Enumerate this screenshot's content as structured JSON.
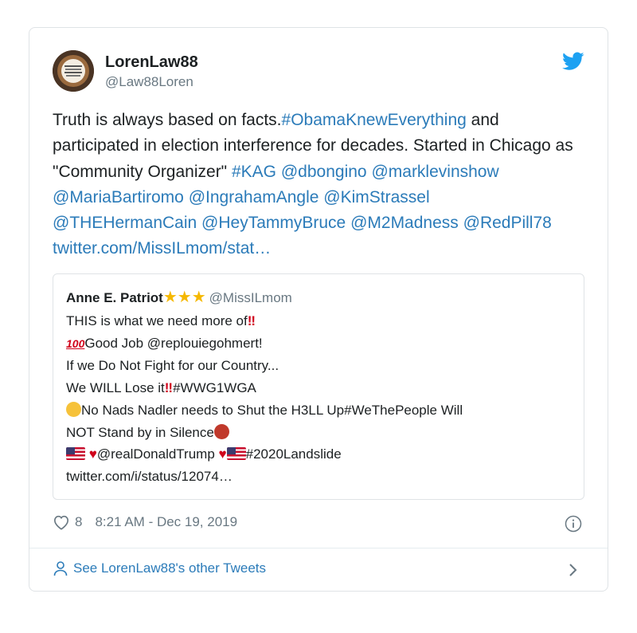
{
  "author": {
    "name": "LorenLaw88",
    "handle": "@Law88Loren",
    "avatar_icon": "profile-avatar",
    "platform_icon": "twitter-bird-icon"
  },
  "tweet": {
    "segments": [
      {
        "text": "Truth is always based on facts.",
        "link": false
      },
      {
        "text": "#ObamaKnewEverything",
        "link": true
      },
      {
        "text": " and participated in election interference for decades. Started in Chicago as \"Community Organizer\"  ",
        "link": false
      },
      {
        "text": "#KAG",
        "link": true
      },
      {
        "text": " ",
        "link": false
      },
      {
        "text": "@dbongino",
        "link": true
      },
      {
        "text": " ",
        "link": false
      },
      {
        "text": "@marklevinshow",
        "link": true
      },
      {
        "text": " ",
        "link": false
      },
      {
        "text": "@MariaBartiromo",
        "link": true
      },
      {
        "text": " ",
        "link": false
      },
      {
        "text": "@IngrahamAngle",
        "link": true
      },
      {
        "text": " ",
        "link": false
      },
      {
        "text": "@KimStrassel",
        "link": true
      },
      {
        "text": " ",
        "link": false
      },
      {
        "text": "@THEHermanCain",
        "link": true
      },
      {
        "text": " ",
        "link": false
      },
      {
        "text": "@HeyTammyBruce",
        "link": true
      },
      {
        "text": " ",
        "link": false
      },
      {
        "text": "@M2Madness",
        "link": true
      },
      {
        "text": " ",
        "link": false
      },
      {
        "text": "@RedPill78",
        "link": true
      },
      {
        "text": " ",
        "link": false
      },
      {
        "text": "twitter.com/MissILmom/stat…",
        "link": true
      }
    ]
  },
  "quote": {
    "name": "Anne E. Patriot",
    "stars": "★★★",
    "handle": "@MissILmom",
    "line1": "THIS is what we need more of",
    "bang": "‼",
    "hundred": "100",
    "line2": "Good Job @replouiegohmert!",
    "line3": "If we Do Not Fight for our Country...",
    "line4a": "We WILL Lose it",
    "line4b": "#WWG1WGA",
    "line5": "No Nads Nadler needs to Shut the H3LL Up#WeThePeople Will",
    "line6": "NOT Stand by in Silence",
    "heart": "♥",
    "line7a": "@realDonaldTrump",
    "line7b": "#2020Landslide",
    "line8": "twitter.com/i/status/12074…"
  },
  "footer": {
    "likes": "8",
    "timestamp": "8:21 AM - Dec 19, 2019",
    "like_icon": "heart-outline-icon",
    "info_icon": "info-icon"
  },
  "more_tweets": {
    "label": "See LorenLaw88's other Tweets",
    "icon": "person-icon",
    "chevron": "chevron-right-icon"
  },
  "colors": {
    "link": "#2b7bb9",
    "muted": "#697882",
    "text": "#1c2022",
    "border": "#dfe3e6",
    "bird": "#1da1f2",
    "star": "#f5b800",
    "red": "#d0021b"
  }
}
